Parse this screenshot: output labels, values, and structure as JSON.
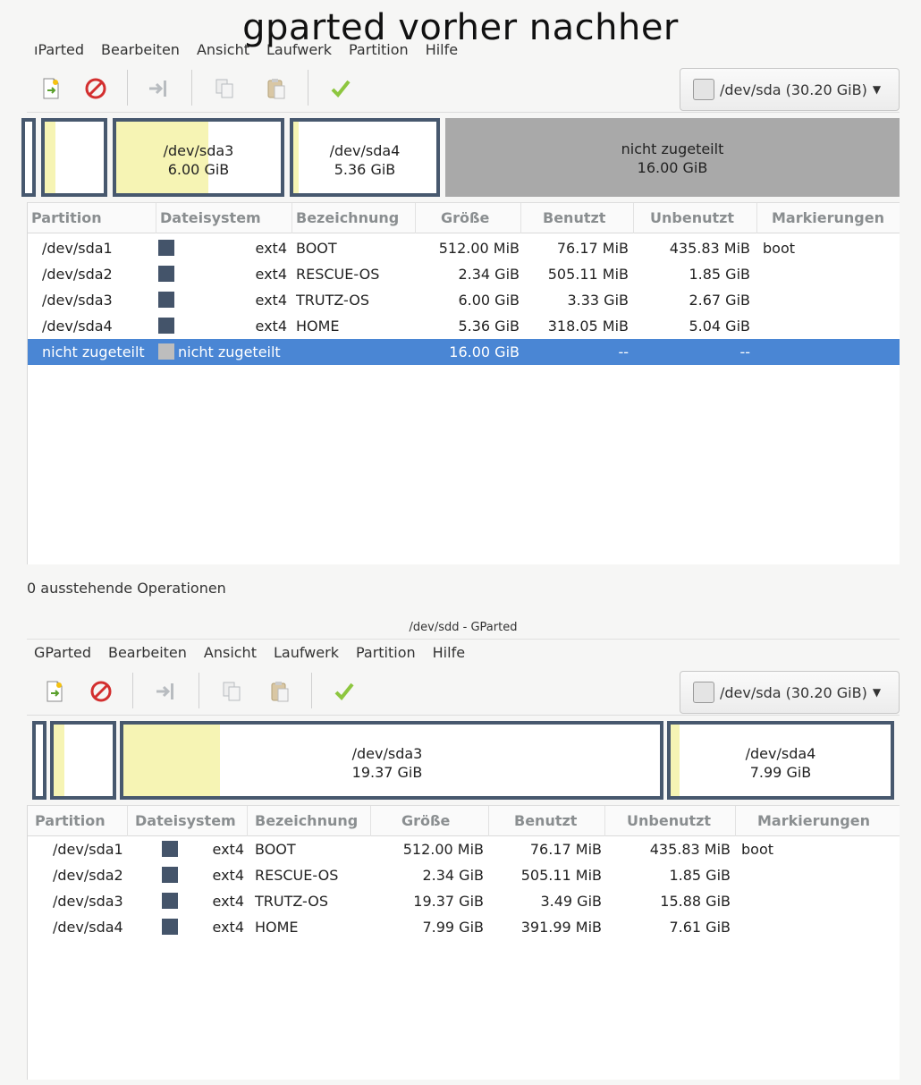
{
  "caption": "gparted vorher nachher",
  "colors": {
    "partition_border": "#47586e",
    "used_space": "#f6f4b4",
    "unallocated": "#a9a9a9",
    "selection": "#4a86d4"
  },
  "before": {
    "menu": [
      "ıParted",
      "Bearbeiten",
      "Ansicht",
      "Laufwerk",
      "Partition",
      "Hilfe"
    ],
    "device": "/dev/sda (30.20 GiB)",
    "toolbar_icons": [
      "new-icon",
      "delete-icon",
      "resize-icon",
      "copy-icon",
      "paste-icon",
      "apply-icon"
    ],
    "bar": [
      {
        "name": "/dev/sda3",
        "size": "6.00 GiB"
      },
      {
        "name": "/dev/sda4",
        "size": "5.36 GiB"
      },
      {
        "name": "nicht zugeteilt",
        "size": "16.00 GiB"
      }
    ],
    "headers": [
      "Partition",
      "Dateisystem",
      "Bezeichnung",
      "Größe",
      "Benutzt",
      "Unbenutzt",
      "Markierungen"
    ],
    "rows": [
      {
        "partition": "/dev/sda1",
        "fs": "ext4",
        "label": "BOOT",
        "size": "512.00 MiB",
        "used": "76.17 MiB",
        "unused": "435.83 MiB",
        "flags": "boot"
      },
      {
        "partition": "/dev/sda2",
        "fs": "ext4",
        "label": "RESCUE-OS",
        "size": "2.34 GiB",
        "used": "505.11 MiB",
        "unused": "1.85 GiB",
        "flags": ""
      },
      {
        "partition": "/dev/sda3",
        "fs": "ext4",
        "label": "TRUTZ-OS",
        "size": "6.00 GiB",
        "used": "3.33 GiB",
        "unused": "2.67 GiB",
        "flags": ""
      },
      {
        "partition": "/dev/sda4",
        "fs": "ext4",
        "label": "HOME",
        "size": "5.36 GiB",
        "used": "318.05 MiB",
        "unused": "5.04 GiB",
        "flags": ""
      },
      {
        "partition": "nicht zugeteilt",
        "fs": "nicht zugeteilt",
        "label": "",
        "size": "16.00 GiB",
        "used": "--",
        "unused": "--",
        "flags": ""
      }
    ],
    "status": "0 ausstehende Operationen"
  },
  "after": {
    "window_title": "/dev/sdd - GParted",
    "menu": [
      "GParted",
      "Bearbeiten",
      "Ansicht",
      "Laufwerk",
      "Partition",
      "Hilfe"
    ],
    "device": "/dev/sda (30.20 GiB)",
    "toolbar_icons": [
      "new-icon",
      "delete-icon",
      "resize-icon",
      "copy-icon",
      "paste-icon",
      "apply-icon"
    ],
    "bar": [
      {
        "name": "/dev/sda3",
        "size": "19.37 GiB"
      },
      {
        "name": "/dev/sda4",
        "size": "7.99 GiB"
      }
    ],
    "headers": [
      "Partition",
      "Dateisystem",
      "Bezeichnung",
      "Größe",
      "Benutzt",
      "Unbenutzt",
      "Markierungen"
    ],
    "rows": [
      {
        "partition": "/dev/sda1",
        "fs": "ext4",
        "label": "BOOT",
        "size": "512.00 MiB",
        "used": "76.17 MiB",
        "unused": "435.83 MiB",
        "flags": "boot"
      },
      {
        "partition": "/dev/sda2",
        "fs": "ext4",
        "label": "RESCUE-OS",
        "size": "2.34 GiB",
        "used": "505.11 MiB",
        "unused": "1.85 GiB",
        "flags": ""
      },
      {
        "partition": "/dev/sda3",
        "fs": "ext4",
        "label": "TRUTZ-OS",
        "size": "19.37 GiB",
        "used": "3.49 GiB",
        "unused": "15.88 GiB",
        "flags": ""
      },
      {
        "partition": "/dev/sda4",
        "fs": "ext4",
        "label": "HOME",
        "size": "7.99 GiB",
        "used": "391.99 MiB",
        "unused": "7.61 GiB",
        "flags": ""
      }
    ]
  }
}
